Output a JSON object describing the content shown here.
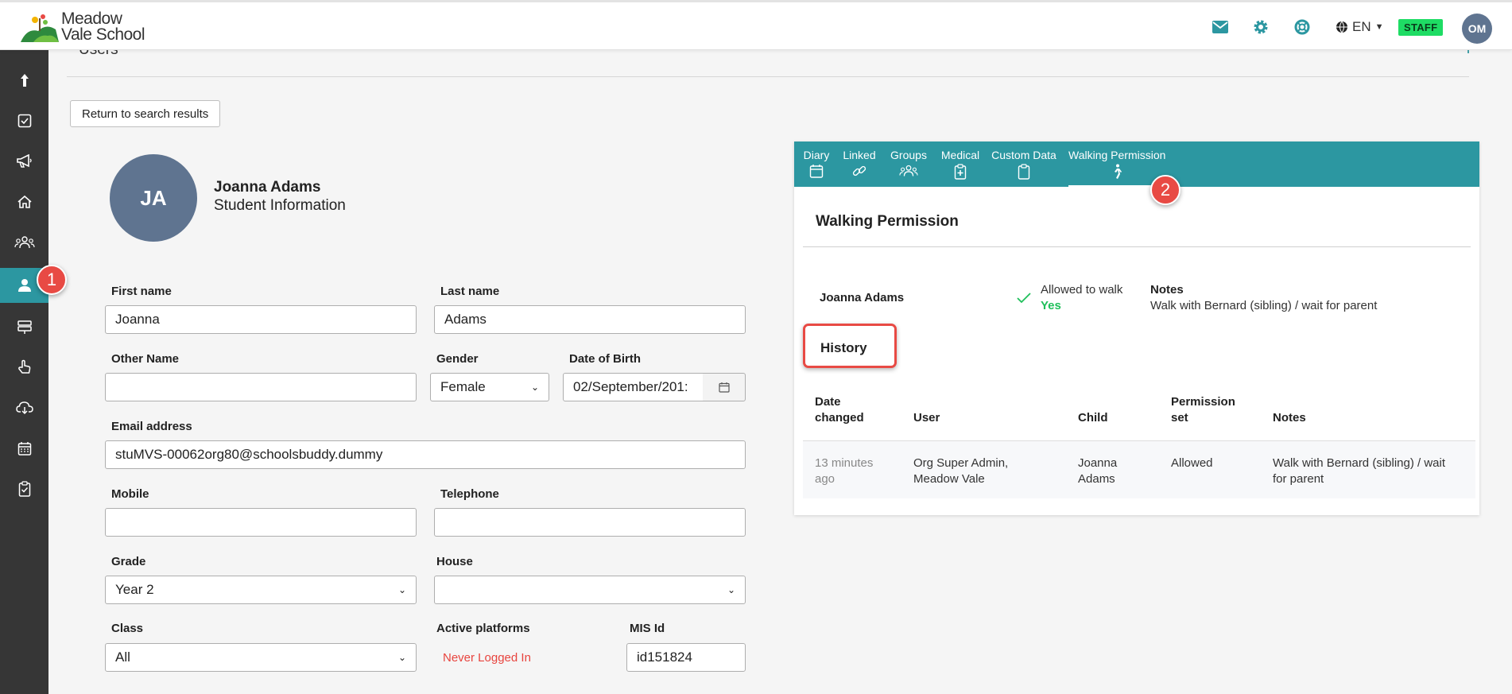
{
  "app": {
    "logo_line1": "Meadow",
    "logo_line2": "Vale School",
    "language": "EN",
    "role_badge": "STAFF",
    "user_initials": "OM"
  },
  "colors": {
    "teal": "#2c97a1",
    "sidebar": "#363636",
    "staff_badge": "#1edc64",
    "annotation_red": "#e84a44",
    "yes_green": "#1fbf5a",
    "never_logged_red": "#e8443e"
  },
  "header_icons": [
    "mail-icon",
    "gear-icon",
    "lifebuoy-icon",
    "globe-icon"
  ],
  "sidebar": {
    "items": [
      {
        "name": "upload-icon"
      },
      {
        "name": "checkbox-icon"
      },
      {
        "name": "megaphone-icon"
      },
      {
        "name": "home-icon"
      },
      {
        "name": "group-icon"
      },
      {
        "name": "user-icon",
        "active": true
      },
      {
        "name": "signpost-icon"
      },
      {
        "name": "hand-pointer-icon"
      },
      {
        "name": "cloud-download-icon"
      },
      {
        "name": "calendar-icon"
      },
      {
        "name": "clipboard-check-icon"
      }
    ]
  },
  "annotations": {
    "badge1": "1",
    "badge2": "2"
  },
  "page": {
    "section_title": "Users",
    "add_symbol": "+",
    "return_button": "Return to search results"
  },
  "student": {
    "initials": "JA",
    "name": "Joanna Adams",
    "subtitle": "Student Information"
  },
  "form": {
    "first_name_label": "First name",
    "first_name": "Joanna",
    "last_name_label": "Last name",
    "last_name": "Adams",
    "other_name_label": "Other Name",
    "other_name": "",
    "gender_label": "Gender",
    "gender": "Female",
    "dob_label": "Date of Birth",
    "dob": "02/September/201:",
    "email_label": "Email address",
    "email": "stuMVS-00062org80@schoolsbuddy.dummy",
    "mobile_label": "Mobile",
    "mobile": "",
    "telephone_label": "Telephone",
    "telephone": "",
    "grade_label": "Grade",
    "grade": "Year 2",
    "house_label": "House",
    "house": "",
    "class_label": "Class",
    "class": "All",
    "active_platforms_label": "Active platforms",
    "active_platforms": "Never Logged In",
    "mis_id_label": "MIS Id",
    "mis_id": "id151824"
  },
  "tabs": [
    {
      "label": "Diary",
      "icon": "calendar-icon"
    },
    {
      "label": "Linked",
      "icon": "link-icon"
    },
    {
      "label": "Groups",
      "icon": "group-icon"
    },
    {
      "label": "Medical",
      "icon": "medical-clipboard-icon"
    },
    {
      "label": "Custom Data",
      "icon": "clipboard-icon"
    },
    {
      "label": "Walking Permission",
      "icon": "walking-icon",
      "active": true
    }
  ],
  "walking": {
    "title": "Walking Permission",
    "student_name": "Joanna Adams",
    "allowed_label": "Allowed to walk",
    "allowed_value": "Yes",
    "notes_label": "Notes",
    "notes": "Walk with Bernard (sibling) / wait for parent",
    "history_label": "History",
    "history_headers": {
      "date_1": "Date",
      "date_2": "changed",
      "user": "User",
      "child": "Child",
      "perm_1": "Permission",
      "perm_2": "set",
      "notes": "Notes"
    },
    "history_rows": [
      {
        "date_1": "13 minutes",
        "date_2": "ago",
        "user_1": "Org Super Admin,",
        "user_2": "Meadow Vale",
        "child_1": "Joanna",
        "child_2": "Adams",
        "permission": "Allowed",
        "notes_1": "Walk with Bernard (sibling) / wait",
        "notes_2": "for parent"
      }
    ]
  }
}
